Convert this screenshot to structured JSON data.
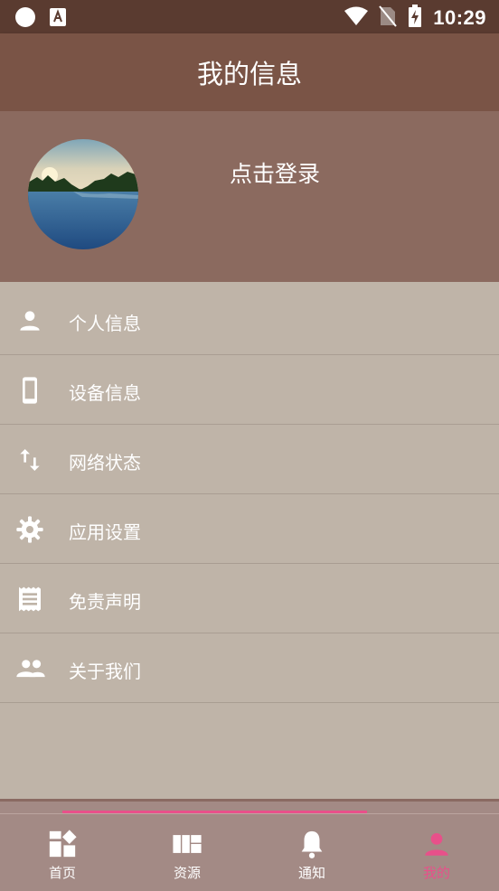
{
  "status_bar": {
    "time": "10:29"
  },
  "app_bar": {
    "title": "我的信息"
  },
  "profile": {
    "login_text": "点击登录"
  },
  "menu": {
    "items": [
      {
        "label": "个人信息",
        "icon": "person-icon"
      },
      {
        "label": "设备信息",
        "icon": "smartphone-icon"
      },
      {
        "label": "网络状态",
        "icon": "swap-vert-icon"
      },
      {
        "label": "应用设置",
        "icon": "gear-icon"
      },
      {
        "label": "免责声明",
        "icon": "receipt-icon"
      },
      {
        "label": "关于我们",
        "icon": "people-icon"
      }
    ]
  },
  "bottom_nav": {
    "items": [
      {
        "label": "首页",
        "icon": "dashboard-icon"
      },
      {
        "label": "资源",
        "icon": "quilt-icon"
      },
      {
        "label": "通知",
        "icon": "bell-icon"
      },
      {
        "label": "我的",
        "icon": "person-icon"
      }
    ],
    "active_index": 3,
    "active_color": "#e8508a"
  },
  "colors": {
    "status_bar": "#5a3b30",
    "app_bar": "#7a5446",
    "profile_bg": "#8b6a5f",
    "menu_bg": "#bfb4a8",
    "nav_bg": "#a38a85"
  }
}
